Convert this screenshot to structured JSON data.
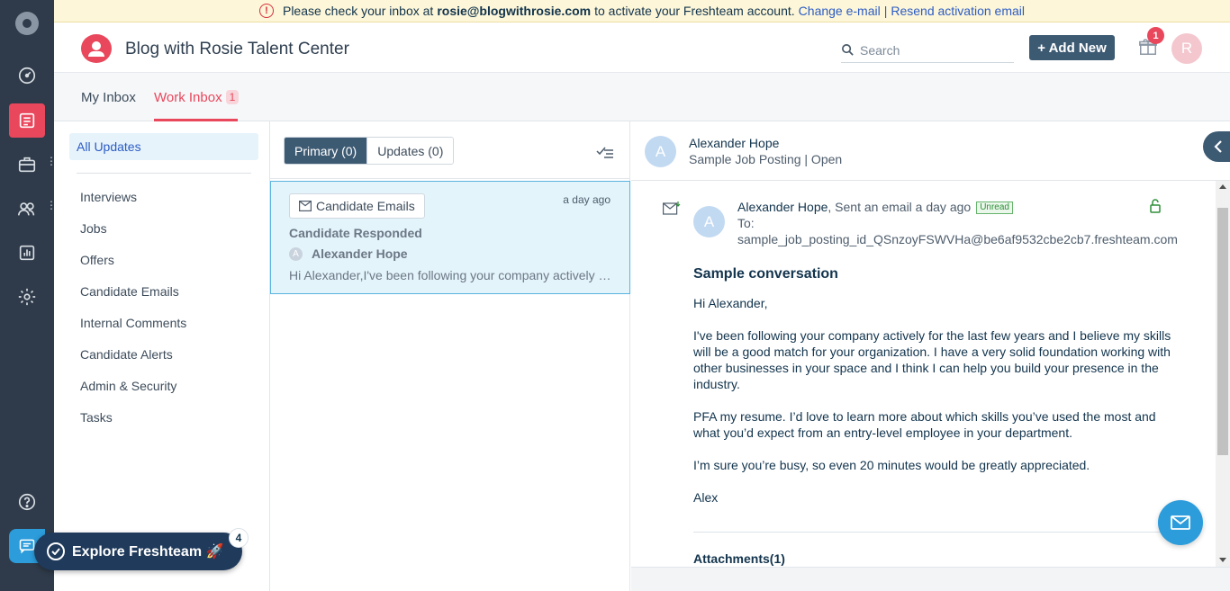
{
  "banner": {
    "prefix": "Please check your inbox at",
    "email": "rosie@blogwithrosie.com",
    "suffix": "to activate your Freshteam account.",
    "change_link": "Change e-mail",
    "separator": "|",
    "resend_link": "Resend activation email"
  },
  "header": {
    "title": "Blog with Rosie Talent Center",
    "search_placeholder": "Search",
    "add_new": "+ Add New",
    "gift_badge": "1",
    "avatar_initial": "R"
  },
  "tabs": {
    "my_inbox": "My Inbox",
    "work_inbox": "Work Inbox",
    "work_inbox_count": "1"
  },
  "filters": {
    "all": "All Updates",
    "items": [
      "Interviews",
      "Jobs",
      "Offers",
      "Candidate Emails",
      "Internal Comments",
      "Candidate Alerts",
      "Admin & Security",
      "Tasks"
    ]
  },
  "list": {
    "primary": "Primary (0)",
    "updates": "Updates (0)",
    "card": {
      "category": "Candidate Emails",
      "time": "a day ago",
      "title": "Candidate Responded",
      "avatar": "A",
      "name": "Alexander Hope",
      "snippet": "Hi Alexander,I've been following your company actively for the last few years"
    }
  },
  "detail": {
    "avatar": "A",
    "name": "Alexander Hope",
    "subtitle": "Sample Job Posting | Open",
    "email": {
      "avatar": "A",
      "from_name": "Alexander Hope",
      "from_action": ", Sent an email a day ago",
      "unread": "Unread",
      "to_label": "To:",
      "to_address": "sample_job_posting_id_QSnzoyFSWVHa@be6af9532cbe2cb7.freshteam.com",
      "subject": "Sample conversation",
      "greeting": "Hi Alexander,",
      "para1": "I've been following your company actively for the last few years and I believe my skills will be a good match for your organization. I have a very solid foundation working with other businesses in your space and I think I can help you build your presence in the industry.",
      "para2": "PFA my resume. I’d love to learn more about which skills you’ve used the most and what you’d expect from an entry-level employee in your department.",
      "para3": "I’m sure you’re busy, so even 20 minutes would be greatly appreciated.",
      "signoff": "Alex",
      "attachments": "Attachments(1)"
    }
  },
  "explore": {
    "label": "Explore Freshteam 🚀",
    "badge": "4"
  }
}
